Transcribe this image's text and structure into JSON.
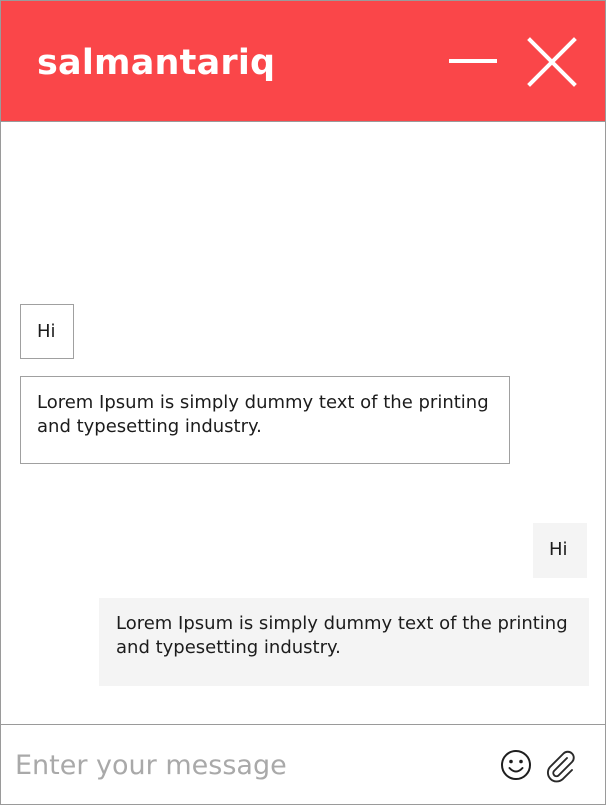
{
  "theme": {
    "accent": "#fa4649"
  },
  "header": {
    "title": "salmantariq",
    "minimize_icon": "minimize-icon",
    "close_icon": "close-icon"
  },
  "messages": [
    {
      "direction": "incoming",
      "text": "Hi"
    },
    {
      "direction": "incoming",
      "text": "Lorem Ipsum is simply dummy text of the printing and typesetting industry."
    },
    {
      "direction": "outgoing",
      "text": "Hi"
    },
    {
      "direction": "outgoing",
      "text": "Lorem Ipsum is simply dummy text of the printing and typesetting industry."
    }
  ],
  "composer": {
    "placeholder": "Enter your message",
    "value": "",
    "emoji_icon": "emoji-icon",
    "attach_icon": "paperclip-icon"
  }
}
